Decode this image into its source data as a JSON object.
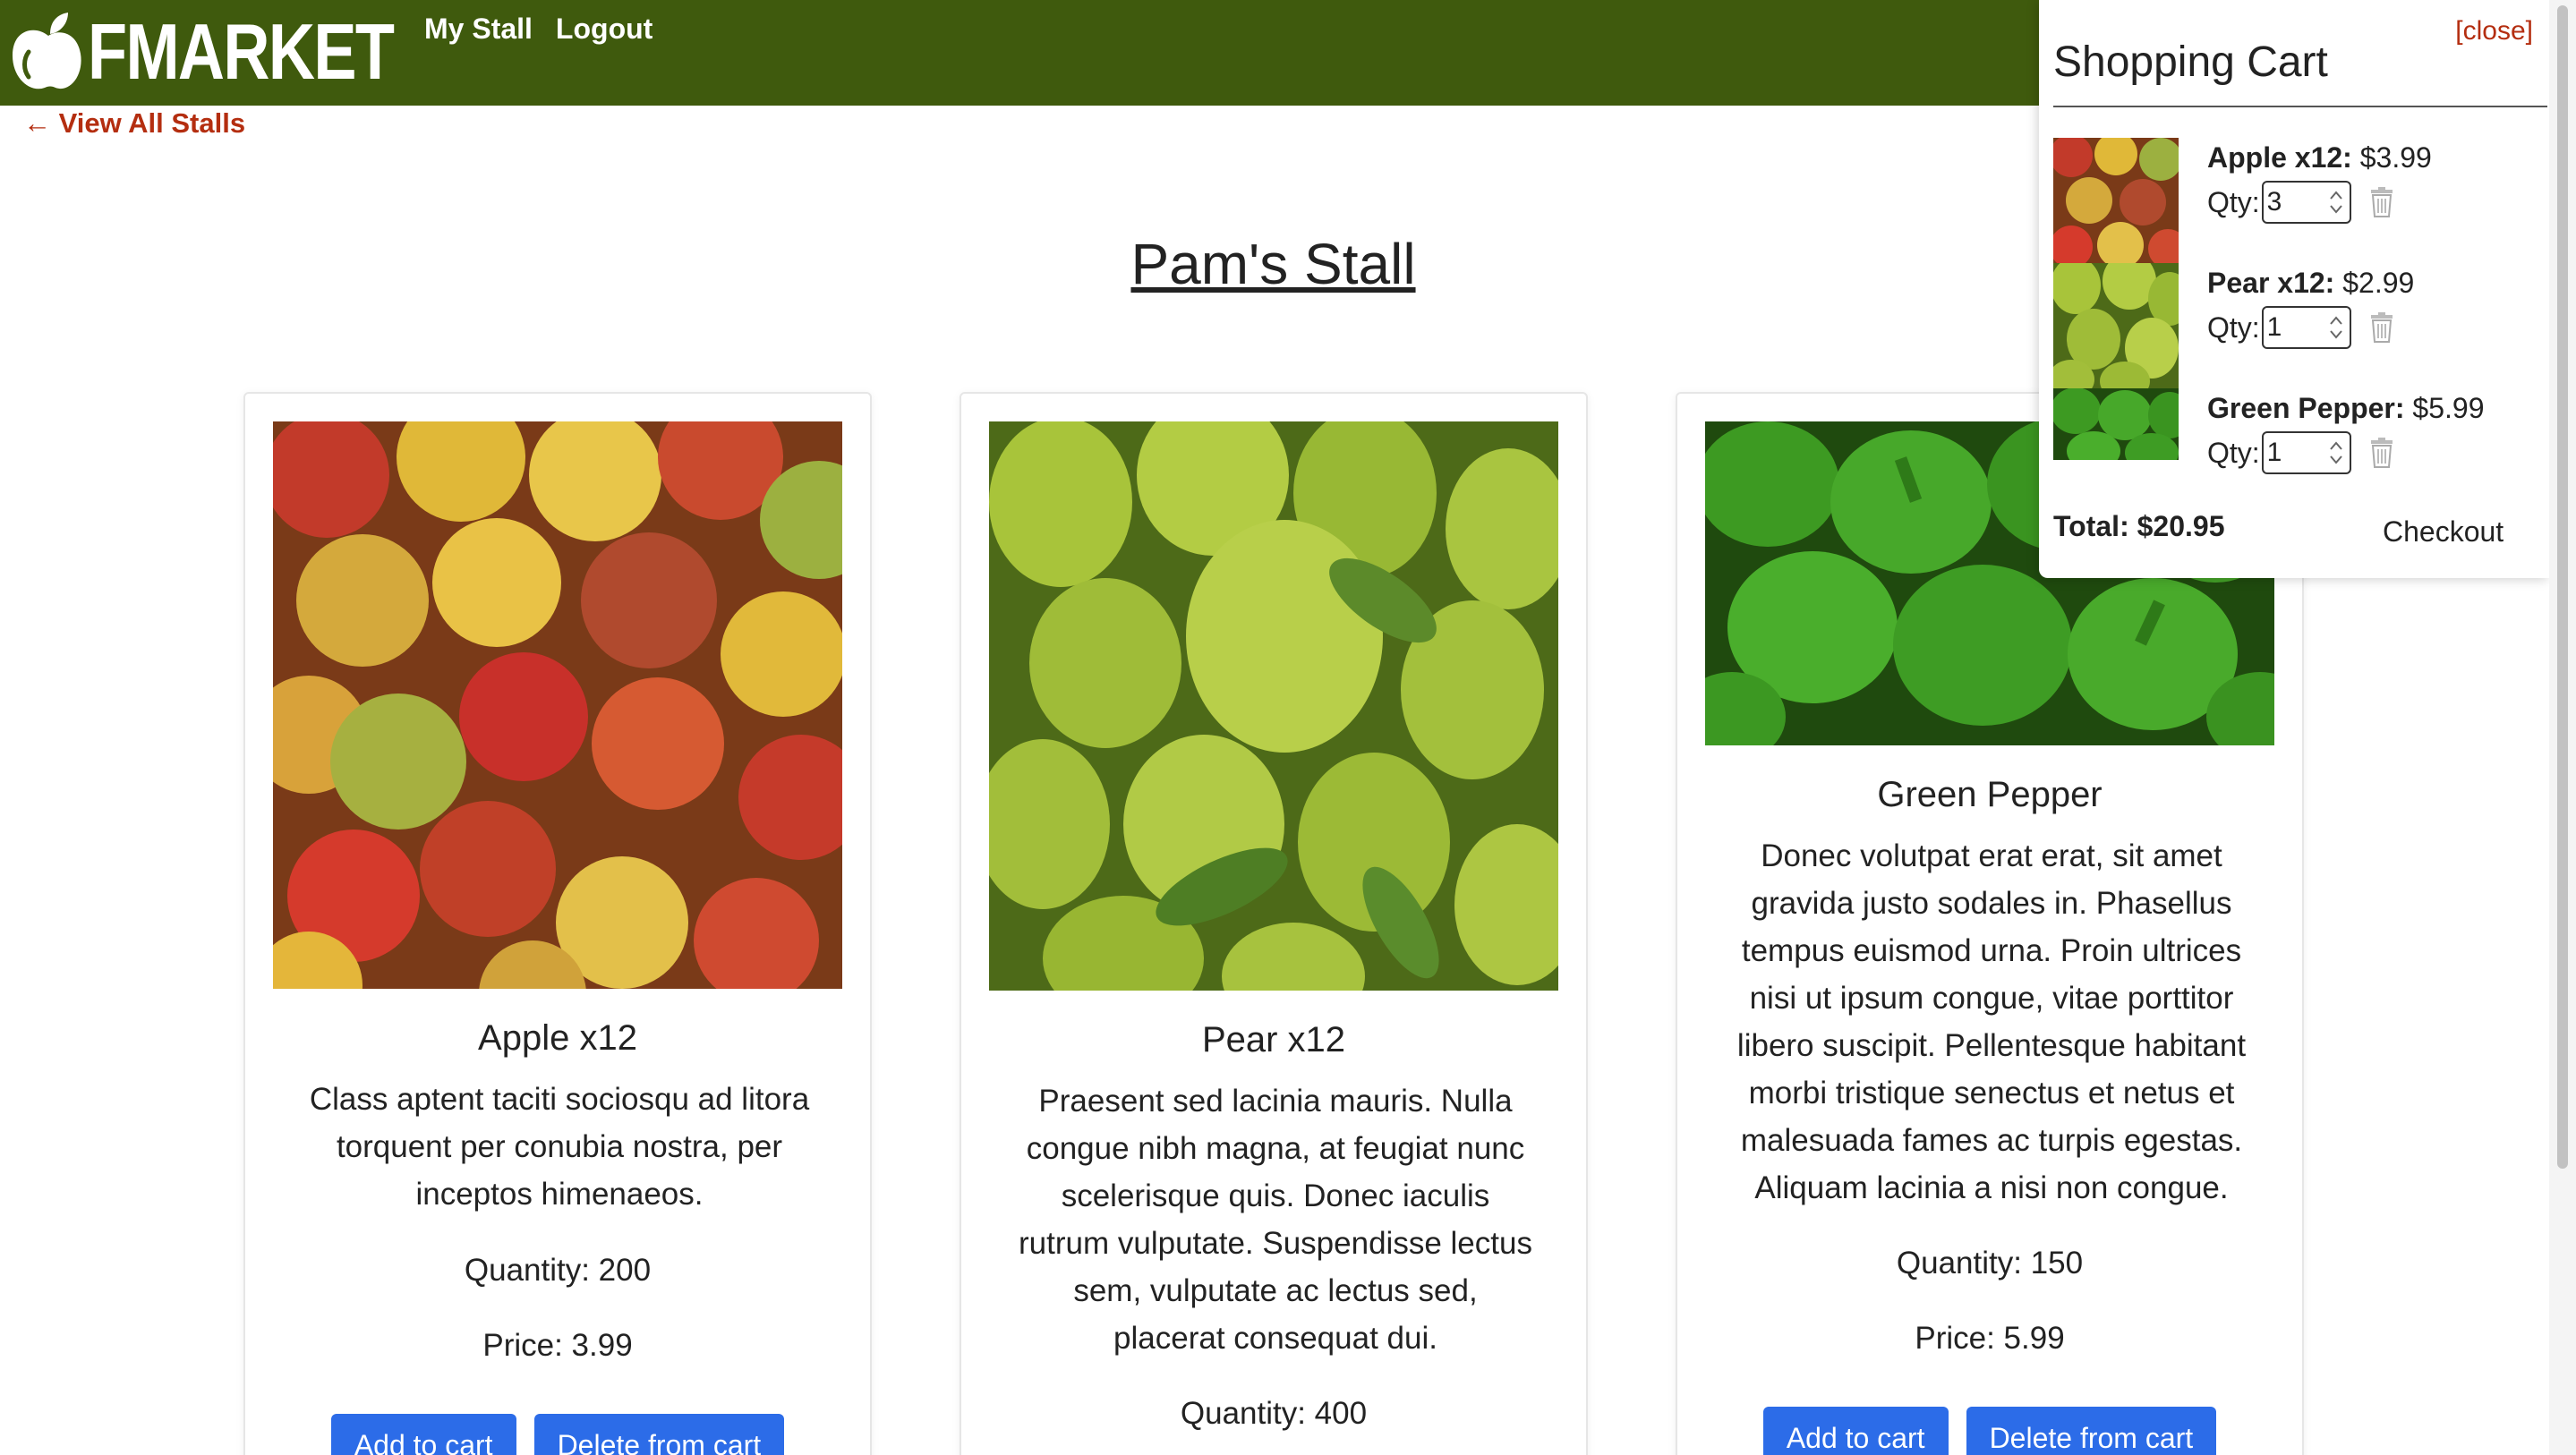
{
  "header": {
    "logo_text": "FMARKET",
    "nav": [
      {
        "label": "My Stall"
      },
      {
        "label": "Logout"
      }
    ],
    "bg_color": "#3f5a0d"
  },
  "back_link": "← View All Stalls",
  "stall_title": "Pam's Stall",
  "products": [
    {
      "name": "Apple x12",
      "description": "Class aptent taciti sociosqu ad litora torquent per conubia nostra, per inceptos himenaeos.",
      "quantity": "Quantity: 200",
      "price": "Price: 3.99",
      "add_label": "Add to cart",
      "delete_label": "Delete from cart"
    },
    {
      "name": "Pear x12",
      "description": "Praesent sed lacinia mauris. Nulla congue nibh magna, at feugiat nunc scelerisque quis. Donec iaculis rutrum vulputate. Suspendisse lectus sem, vulputate ac lectus sed, placerat consequat dui.",
      "quantity": "Quantity: 400"
    },
    {
      "name": "Green Pepper",
      "description": "Donec volutpat erat erat, sit amet gravida justo sodales in. Phasellus tempus euismod urna. Proin ultrices nisi ut ipsum congue, vitae porttitor libero suscipit. Pellentesque habitant morbi tristique senectus et netus et malesuada fames ac turpis egestas. Aliquam lacinia a nisi non congue.",
      "quantity": "Quantity: 150",
      "price": "Price: 5.99",
      "add_label": "Add to cart",
      "delete_label": "Delete from cart"
    }
  ],
  "cart": {
    "close_label": "[close]",
    "title": "Shopping Cart",
    "qty_label": "Qty:",
    "items": [
      {
        "name": "Apple x12:",
        "price": "$3.99",
        "qty": "3"
      },
      {
        "name": "Pear x12:",
        "price": "$2.99",
        "qty": "1"
      },
      {
        "name": "Green Pepper:",
        "price": "$5.99",
        "qty": "1"
      }
    ],
    "total": "Total: $20.95",
    "checkout_label": "Checkout"
  },
  "colors": {
    "accent_link": "#b42e10",
    "button": "#2c6ce8"
  }
}
